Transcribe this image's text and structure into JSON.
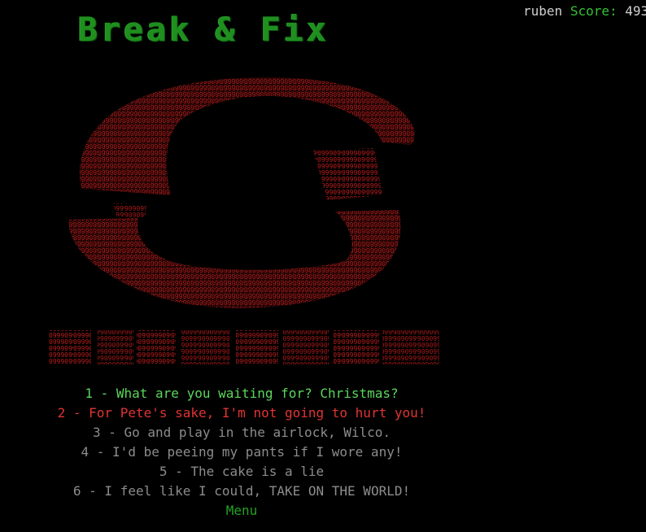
{
  "header": {
    "title": "Break & Fix",
    "username": "ruben",
    "score_label": "Score:",
    "score_value": "493"
  },
  "colors": {
    "background": "#000000",
    "title_green": "#1f8f1f",
    "logo_red": "#b31b1b",
    "option_highlight_green": "#5cd65c",
    "option_hover_red": "#e23434",
    "option_gray": "#8c8c8c",
    "menu_green": "#22a322"
  },
  "logo": {
    "description_icon": "ascii-art-portal-logo",
    "charset": "09"
  },
  "options": [
    {
      "label": "1 - What are you waiting for? Christmas?"
    },
    {
      "label": "2 - For Pete's sake, I'm not going to hurt you!"
    },
    {
      "label": "3 - Go and play in the airlock, Wilco."
    },
    {
      "label": "4 - I'd be peeing my pants if I wore any!"
    },
    {
      "label": "5 - The cake is a lie"
    },
    {
      "label": "6 - I feel like I could, TAKE ON THE WORLD!"
    }
  ],
  "menu_label": "Menu"
}
